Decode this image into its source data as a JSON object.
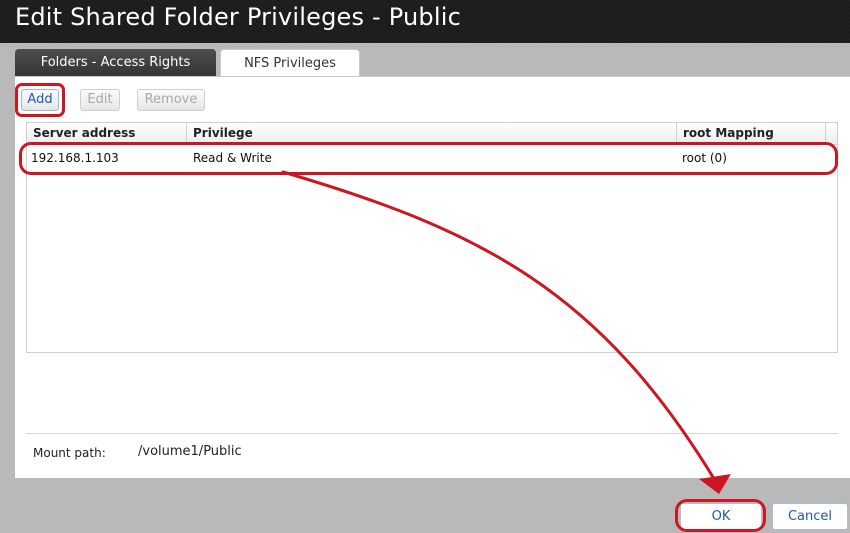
{
  "window": {
    "title": "Edit Shared Folder Privileges - Public"
  },
  "tabs": [
    {
      "label": "Folders - Access Rights",
      "active": false
    },
    {
      "label": "NFS Privileges",
      "active": true
    }
  ],
  "toolbar": {
    "add_label": "Add",
    "edit_label": "Edit",
    "remove_label": "Remove"
  },
  "table": {
    "columns": [
      "Server address",
      "Privilege",
      "root Mapping"
    ],
    "rows": [
      {
        "server_address": "192.168.1.103",
        "privilege": "Read & Write",
        "root_mapping": "root (0)"
      }
    ]
  },
  "mount": {
    "label": "Mount path:",
    "value": "/volume1/Public"
  },
  "dialog_buttons": {
    "ok_label": "OK",
    "cancel_label": "Cancel"
  },
  "colors": {
    "highlight": "#cc1722",
    "title_bar": "#1b1b1b",
    "link_blue": "#1f5aa8"
  }
}
